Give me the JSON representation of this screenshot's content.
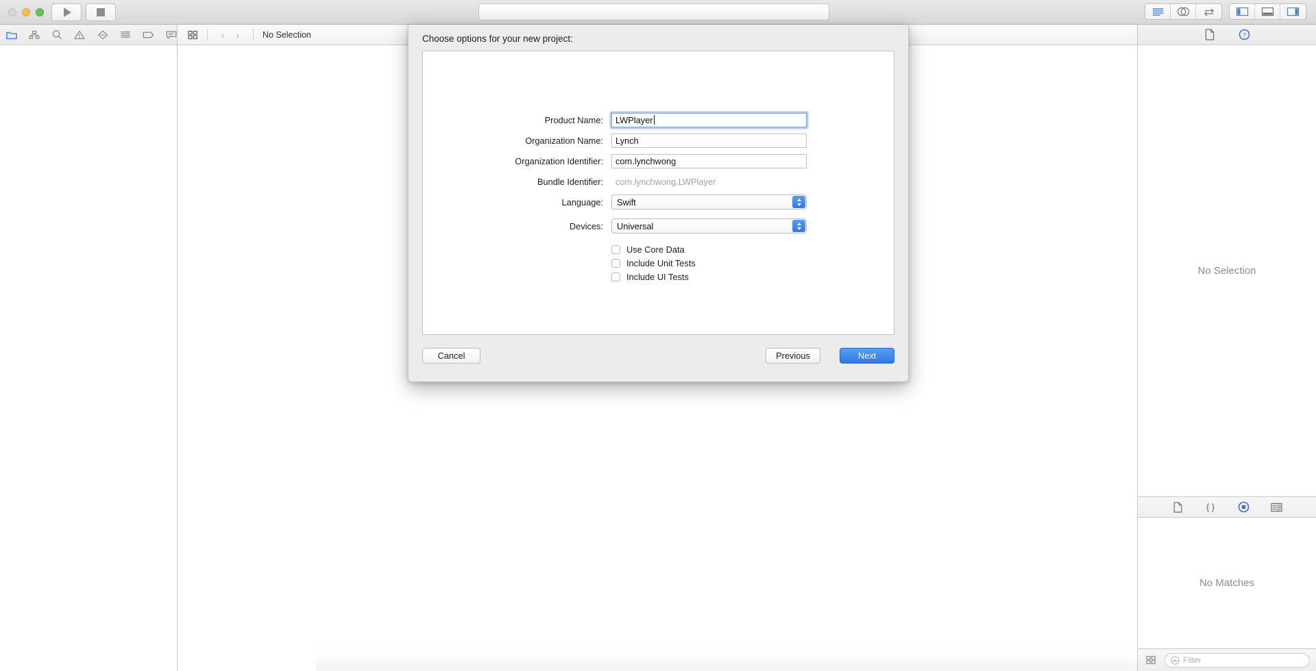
{
  "titlebar": {
    "window_controls": [
      "close",
      "minimize",
      "zoom"
    ],
    "run_button": "run-icon",
    "stop_button": "stop-icon",
    "search_value": "",
    "search_placeholder": "",
    "right_groups": [
      {
        "icons": [
          "standard-editor-icon",
          "assistant-editor-icon",
          "version-editor-icon"
        ]
      },
      {
        "icons": [
          "toggle-navigator-icon",
          "toggle-debug-area-icon",
          "toggle-utilities-icon"
        ]
      }
    ]
  },
  "navigator": {
    "toolbar_icons": [
      "project-navigator-icon",
      "symbol-navigator-icon",
      "find-navigator-icon",
      "issue-navigator-icon",
      "test-navigator-icon",
      "debug-navigator-icon",
      "breakpoint-navigator-icon",
      "report-navigator-icon"
    ]
  },
  "editor": {
    "jumpbar": {
      "related_items_icon": "related-items-icon",
      "back_icon": "chevron-left-icon",
      "forward_icon": "chevron-right-icon",
      "label": "No Selection"
    }
  },
  "utilities": {
    "top_toolbar_icons": [
      "file-inspector-icon",
      "quick-help-inspector-icon"
    ],
    "top_placeholder": "No Selection",
    "bottom_toolbar_icons": [
      "file-template-library-icon",
      "code-snippet-library-icon",
      "object-library-icon",
      "media-library-icon"
    ],
    "bottom_placeholder": "No Matches",
    "filter": {
      "grid_icon": "library-grid-icon",
      "search_icon": "filter-search-icon",
      "placeholder": "Filter",
      "value": ""
    }
  },
  "sheet": {
    "heading": "Choose options for your new project:",
    "fields": [
      {
        "label": "Product Name:",
        "value": "LWPlayer",
        "type": "text",
        "focused": true
      },
      {
        "label": "Organization Name:",
        "value": "Lynch",
        "type": "text",
        "focused": false
      },
      {
        "label": "Organization Identifier:",
        "value": "com.lynchwong",
        "type": "text",
        "focused": false
      },
      {
        "label": "Bundle Identifier:",
        "value": "com.lynchwong.LWPlayer",
        "type": "static",
        "focused": false
      },
      {
        "label": "Language:",
        "value": "Swift",
        "type": "popup",
        "focused": false
      },
      {
        "label": "Devices:",
        "value": "Universal",
        "type": "popup",
        "focused": false
      }
    ],
    "checkboxes": [
      {
        "label": "Use Core Data",
        "checked": false
      },
      {
        "label": "Include Unit Tests",
        "checked": false
      },
      {
        "label": "Include UI Tests",
        "checked": false
      }
    ],
    "buttons": {
      "cancel": "Cancel",
      "previous": "Previous",
      "next": "Next"
    }
  },
  "colors": {
    "accent_blue": "#2d78e6",
    "focus_ring": "#6ea3e2",
    "window_chrome": "#ececec",
    "placeholder_text": "#8c8c8c"
  }
}
